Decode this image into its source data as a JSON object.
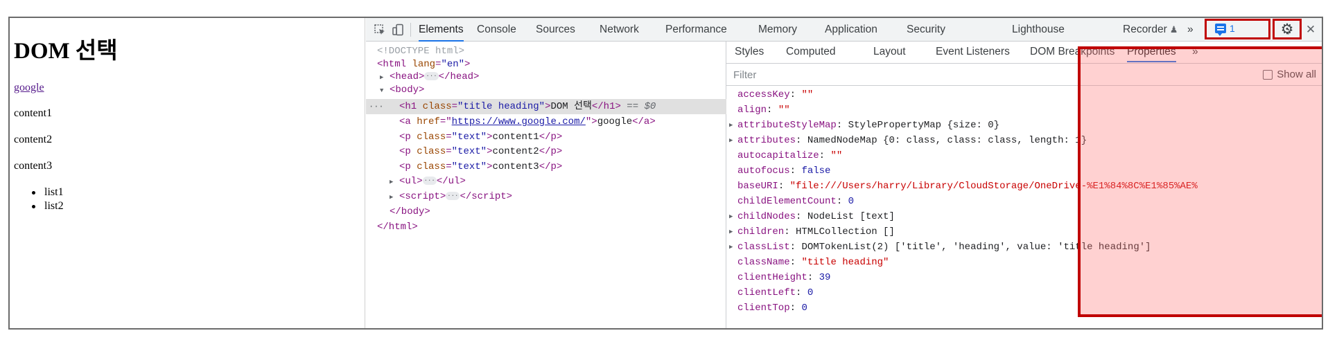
{
  "page": {
    "heading": "DOM 선택",
    "link": "google",
    "paragraphs": [
      "content1",
      "content2",
      "content3"
    ],
    "list": [
      "list1",
      "list2"
    ]
  },
  "devtools": {
    "tabs": [
      "Elements",
      "Console",
      "Sources",
      "Network",
      "Performance",
      "Memory",
      "Application",
      "Security",
      "Lighthouse",
      "Recorder"
    ],
    "active_tab": "Elements",
    "more_tabs": "»",
    "issues_count": "1",
    "menu_icon": "⋮",
    "close_icon": "✕",
    "recorder_icon": "flask-icon",
    "elements": {
      "doctype": "<!DOCTYPE html>",
      "html_open_tag": "html",
      "html_attr": "lang",
      "html_attr_val": "\"en\"",
      "head_tag": "head",
      "body_tag": "body",
      "h1_tag": "h1",
      "h1_attr": "class",
      "h1_attr_val": "\"title heading\"",
      "h1_text": "DOM 선택",
      "h1_note": "== $0",
      "a_tag": "a",
      "a_attr": "href",
      "a_href": "https://www.google.com/",
      "a_text": "google",
      "p_tag": "p",
      "p_attr": "class",
      "p_attr_val": "\"text\"",
      "p_texts": [
        "content1",
        "content2",
        "content3"
      ],
      "ul_tag": "ul",
      "script_tag": "script",
      "body_close": "</body>",
      "html_close": "</html>",
      "selected_dots": "···"
    },
    "sidebar": {
      "tabs": [
        "Styles",
        "Computed",
        "Layout",
        "Event Listeners",
        "DOM Breakpoints",
        "Properties"
      ],
      "active_tab": "Properties",
      "more": "»",
      "filter_placeholder": "Filter",
      "show_all_label": "Show all",
      "properties": [
        {
          "key": "accessKey",
          "value": "\"\"",
          "kind": "string",
          "expandable": false
        },
        {
          "key": "align",
          "value": "\"\"",
          "kind": "string",
          "expandable": false
        },
        {
          "key": "attributeStyleMap",
          "value": "StylePropertyMap {size: 0}",
          "kind": "object",
          "expandable": true
        },
        {
          "key": "attributes",
          "value": "NamedNodeMap {0: class, class: class, length: 1}",
          "kind": "object",
          "expandable": true
        },
        {
          "key": "autocapitalize",
          "value": "\"\"",
          "kind": "string",
          "expandable": false
        },
        {
          "key": "autofocus",
          "value": "false",
          "kind": "bool",
          "expandable": false
        },
        {
          "key": "baseURI",
          "value": "\"file:///Users/harry/Library/CloudStorage/OneDrive-%E1%84%8C%E1%85%AE%",
          "kind": "string",
          "expandable": false
        },
        {
          "key": "childElementCount",
          "value": "0",
          "kind": "number",
          "expandable": false
        },
        {
          "key": "childNodes",
          "value": "NodeList [text]",
          "kind": "object",
          "expandable": true
        },
        {
          "key": "children",
          "value": "HTMLCollection []",
          "kind": "object",
          "expandable": true
        },
        {
          "key": "classList",
          "value": "DOMTokenList(2) ['title', 'heading', value: 'title heading']",
          "kind": "object",
          "expandable": true
        },
        {
          "key": "className",
          "value": "\"title heading\"",
          "kind": "string",
          "expandable": false
        },
        {
          "key": "clientHeight",
          "value": "39",
          "kind": "number",
          "expandable": false
        },
        {
          "key": "clientLeft",
          "value": "0",
          "kind": "number",
          "expandable": false
        },
        {
          "key": "clientTop",
          "value": "0",
          "kind": "number",
          "expandable": false
        }
      ]
    }
  },
  "colors": {
    "highlight_border": "#c00000",
    "highlight_fill": "#ff6f6f",
    "active_tab_underline": "#1a73e8"
  }
}
